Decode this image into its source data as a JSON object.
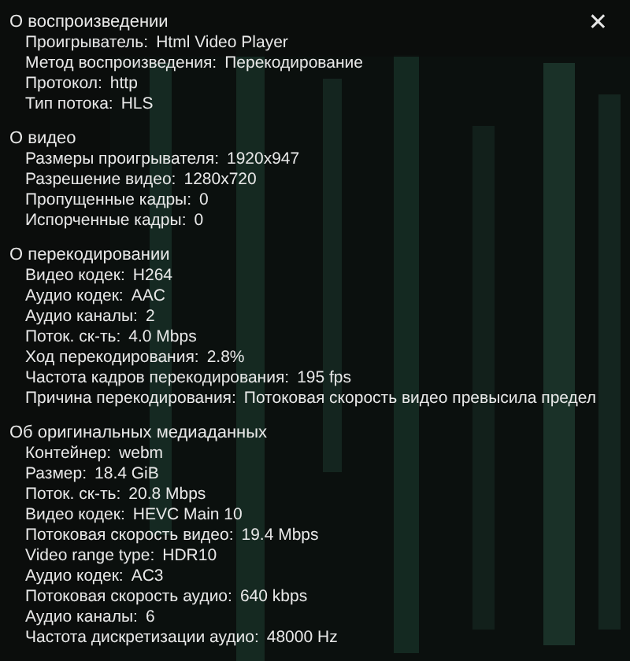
{
  "close_button": {
    "label": "✕"
  },
  "sections": [
    {
      "title": "О воспроизведении",
      "rows": [
        {
          "label": "Проигрыватель:",
          "value": "Html Video Player"
        },
        {
          "label": "Метод воспроизведения:",
          "value": "Перекодирование"
        },
        {
          "label": "Протокол:",
          "value": "http"
        },
        {
          "label": "Тип потока:",
          "value": "HLS"
        }
      ]
    },
    {
      "title": "О видео",
      "rows": [
        {
          "label": "Размеры проигрывателя:",
          "value": "1920x947"
        },
        {
          "label": "Разрешение видео:",
          "value": "1280x720"
        },
        {
          "label": "Пропущенные кадры:",
          "value": "0"
        },
        {
          "label": "Испорченные кадры:",
          "value": "0"
        }
      ]
    },
    {
      "title": "О перекодировании",
      "rows": [
        {
          "label": "Видео кодек:",
          "value": "H264"
        },
        {
          "label": "Аудио кодек:",
          "value": "AAC"
        },
        {
          "label": "Аудио каналы:",
          "value": "2"
        },
        {
          "label": "Поток. ск-ть:",
          "value": "4.0 Mbps"
        },
        {
          "label": "Ход перекодирования:",
          "value": "2.8%"
        },
        {
          "label": "Частота кадров перекодирования:",
          "value": "195 fps"
        },
        {
          "label": "Причина перекодирования:",
          "value": "Потоковая скорость видео превысила предел"
        }
      ]
    },
    {
      "title": "Об оригинальных медиаданных",
      "rows": [
        {
          "label": "Контейнер:",
          "value": "webm"
        },
        {
          "label": "Размер:",
          "value": "18.4 GiB"
        },
        {
          "label": "Поток. ск-ть:",
          "value": "20.8 Mbps"
        },
        {
          "label": "Видео кодек:",
          "value": "HEVC Main 10"
        },
        {
          "label": "Потоковая скорость видео:",
          "value": "19.4 Mbps"
        },
        {
          "label": "Video range type:",
          "value": "HDR10"
        },
        {
          "label": "Аудио кодек:",
          "value": "AC3"
        },
        {
          "label": "Потоковая скорость аудио:",
          "value": "640 kbps"
        },
        {
          "label": "Аудио каналы:",
          "value": "6"
        },
        {
          "label": "Частота дискретизации аудио:",
          "value": "48000 Hz"
        }
      ]
    }
  ]
}
